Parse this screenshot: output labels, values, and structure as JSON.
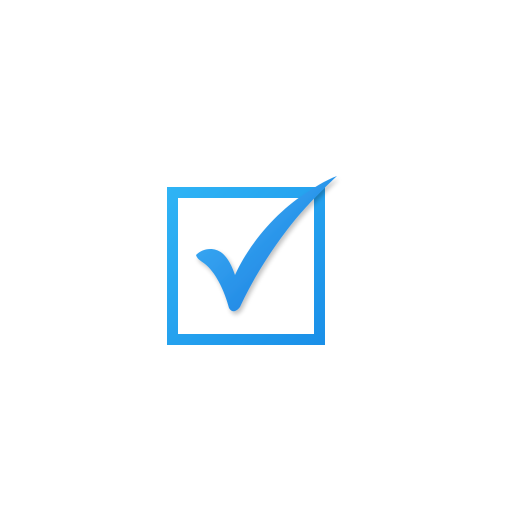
{
  "icon": {
    "name": "checked-checkbox-icon",
    "state": "checked",
    "colors": {
      "box_light": "#2fb4f5",
      "box_dark": "#1a8fe8",
      "check_light": "#42b6f8",
      "check_dark": "#1576dd",
      "shadow": "#000000",
      "background": "#ffffff"
    }
  }
}
